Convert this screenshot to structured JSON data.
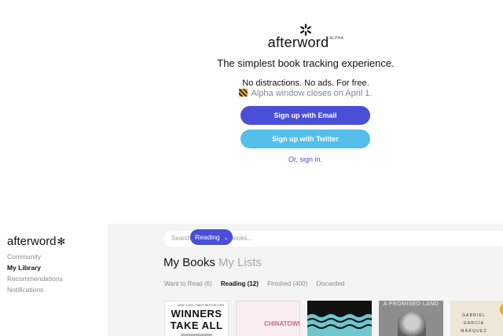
{
  "hero": {
    "logo_text": "afterword",
    "logo_superscript": "ALPHA",
    "tagline": "The simplest book tracking experience.",
    "subline": "No distractions. No ads. For free.",
    "alpha_notice": "Alpha window closes on April 1.",
    "alpha_icon": "construction-barrier-icon",
    "signup_email_label": "Sign up with Email",
    "signup_twitter_label": "Sign up with Twitter",
    "signin_label": "Or, sign in.",
    "colors": {
      "primary": "#4a4fd8",
      "twitter": "#55bfec",
      "alpha_text": "#7b86a8"
    }
  },
  "app": {
    "sidebar": {
      "logo_text": "afterword",
      "logo_icon": "asterisk-icon",
      "items": [
        {
          "label": "Community",
          "active": false
        },
        {
          "label": "My Library",
          "active": true
        },
        {
          "label": "Recommendations",
          "active": false
        },
        {
          "label": "Notifications",
          "active": false
        }
      ]
    },
    "search": {
      "placeholder": "Search all users and books..."
    },
    "headings": {
      "my_books": "My Books",
      "my_lists": "My Lists"
    },
    "tabs": [
      {
        "label": "Want to Read (6)",
        "active": false
      },
      {
        "label": "Reading (12)",
        "active": true
      },
      {
        "label": "Finished (400)",
        "active": false
      },
      {
        "label": "Discarded",
        "active": false
      }
    ],
    "reading_pill": {
      "label": "Reading",
      "icon": "chevron-down-icon"
    },
    "covers": [
      {
        "top_text": "NEW YORK TIMES BESTSELLER",
        "title_line1": "WINNERS",
        "title_line2": "TAKE ALL"
      },
      {
        "title": "CHINATOWN"
      },
      {
        "title": ""
      },
      {
        "title": "A PROMISED LAND"
      },
      {
        "line1": "GABRIEL",
        "line2": "GARCÍA",
        "line3": "MÁRQUEZ"
      }
    ]
  }
}
